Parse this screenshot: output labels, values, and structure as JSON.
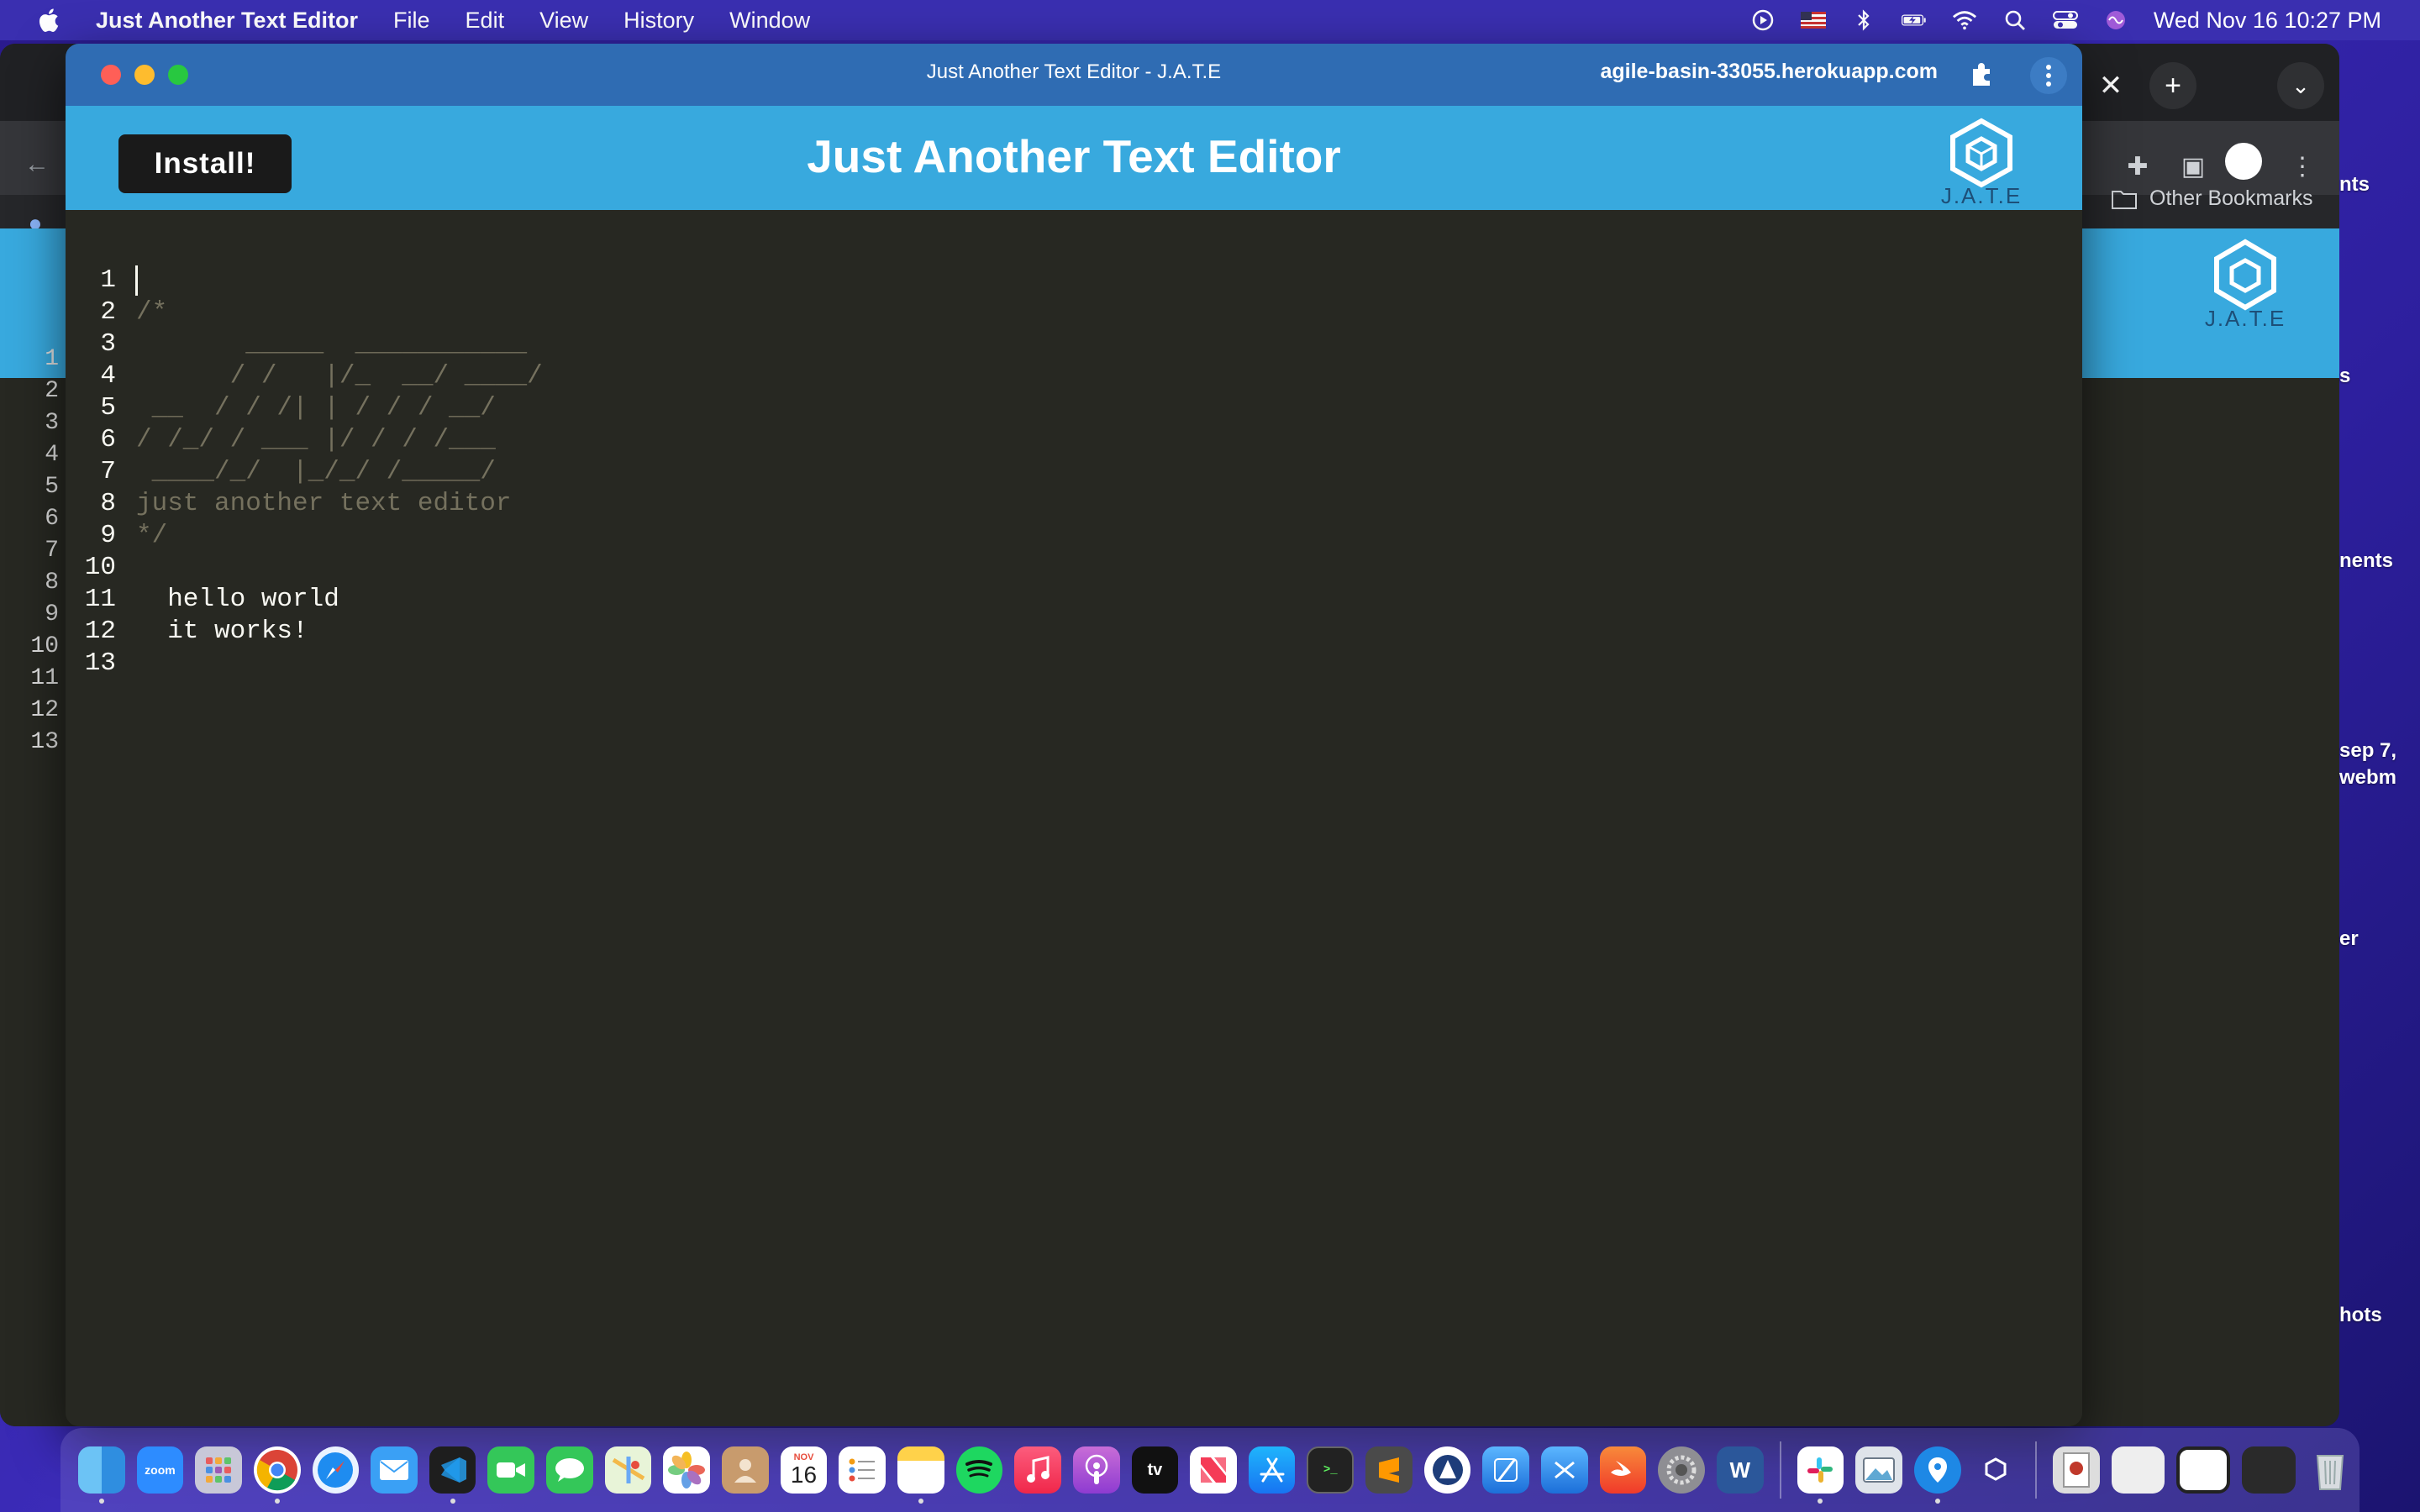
{
  "menubar": {
    "app_name": "Just Another Text Editor",
    "items": [
      "File",
      "Edit",
      "View",
      "History",
      "Window"
    ],
    "clock": "Wed Nov 16  10:27 PM",
    "icons": [
      "play-circle-icon",
      "us-flag-icon",
      "bluetooth-icon",
      "battery-icon",
      "wifi-icon",
      "spotlight-search-icon",
      "control-center-icon",
      "siri-icon"
    ]
  },
  "window": {
    "title": "Just Another Text Editor - J.A.T.E",
    "url": "agile-basin-33055.herokuapp.com"
  },
  "header": {
    "install_label": "Install!",
    "title": "Just Another Text Editor",
    "logo_text": "J.A.T.E"
  },
  "editor": {
    "line_numbers": [
      "1",
      "2",
      "3",
      "4",
      "5",
      "6",
      "7",
      "8",
      "9",
      "10",
      "11",
      "12",
      "13"
    ],
    "lines": [
      {
        "text": "",
        "kind": "plain"
      },
      {
        "text": "/*",
        "kind": "comment"
      },
      {
        "text": "       _____  ___________",
        "kind": "comment"
      },
      {
        "text": "      / /   |/_  __/ ____/",
        "kind": "comment"
      },
      {
        "text": " __  / / /| | / / / __/",
        "kind": "comment"
      },
      {
        "text": "/ /_/ / ___ |/ / / /___",
        "kind": "comment"
      },
      {
        "text": " ____/_/  |_/_/ /_____/",
        "kind": "comment"
      },
      {
        "text": "just another text editor",
        "kind": "comment"
      },
      {
        "text": "*/",
        "kind": "comment"
      },
      {
        "text": "",
        "kind": "plain"
      },
      {
        "text": "  hello world",
        "kind": "plain"
      },
      {
        "text": "  it works!",
        "kind": "plain"
      },
      {
        "text": "",
        "kind": "plain"
      }
    ]
  },
  "background_window": {
    "bookmarks_label": "Other Bookmarks",
    "logo_text": "J.A.T.E",
    "line_numbers": [
      "1",
      "2",
      "3",
      "4",
      "5",
      "6",
      "7",
      "8",
      "9",
      "10",
      "11",
      "12",
      "13"
    ]
  },
  "desktop_labels": [
    "nts",
    "s",
    "nents",
    "sep 7,",
    "webm",
    "er",
    "hots"
  ],
  "dock": {
    "calendar_month": "NOV",
    "calendar_day": "16",
    "zoom_label": "zoom",
    "appletv_label": "tv",
    "apps": [
      "finder",
      "zoom",
      "launchpad",
      "chrome",
      "safari",
      "mail",
      "vscode",
      "facetime",
      "messages",
      "maps",
      "photos",
      "contacts",
      "calendar",
      "reminders",
      "notes",
      "spotify",
      "music",
      "podcasts",
      "appletv",
      "news",
      "appstore",
      "terminal",
      "sublime",
      "workspace",
      "xcode",
      "simulator",
      "swift",
      "system-preferences",
      "word",
      "slack",
      "preview",
      "maps-pin",
      "jate",
      "image-file",
      "screenshot-1",
      "screenshot-2",
      "screenshot-3",
      "trash"
    ]
  },
  "colors": {
    "header": "#38a9de",
    "editor_bg": "#272822",
    "comment": "#75715e",
    "titlebar": "#2f6cb3"
  }
}
